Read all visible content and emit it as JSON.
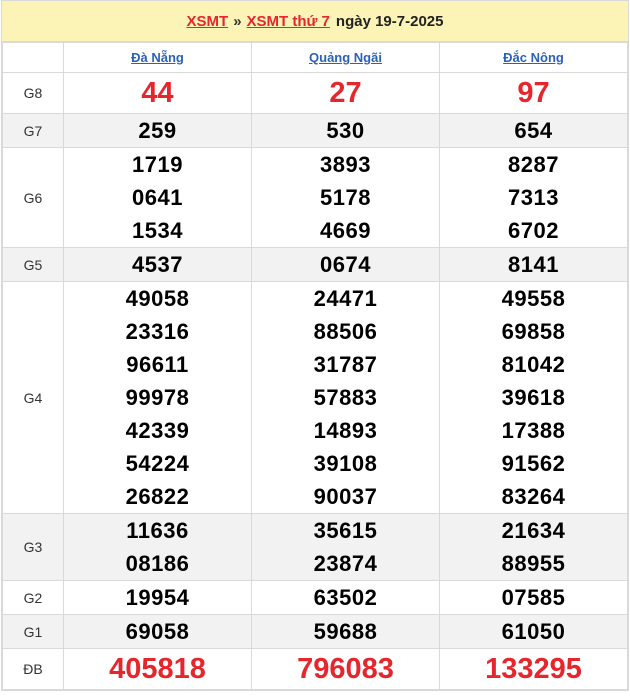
{
  "header": {
    "link1": "XSMT",
    "separator": "»",
    "link2": "XSMT thứ 7",
    "date": "ngày 19-7-2025"
  },
  "provinces": [
    "Đà Nẵng",
    "Quảng Ngãi",
    "Đắc Nông"
  ],
  "prizes": [
    {
      "label": "G8",
      "values": [
        [
          "44"
        ],
        [
          "27"
        ],
        [
          "97"
        ]
      ]
    },
    {
      "label": "G7",
      "values": [
        [
          "259"
        ],
        [
          "530"
        ],
        [
          "654"
        ]
      ]
    },
    {
      "label": "G6",
      "values": [
        [
          "1719",
          "0641",
          "1534"
        ],
        [
          "3893",
          "5178",
          "4669"
        ],
        [
          "8287",
          "7313",
          "6702"
        ]
      ]
    },
    {
      "label": "G5",
      "values": [
        [
          "4537"
        ],
        [
          "0674"
        ],
        [
          "8141"
        ]
      ]
    },
    {
      "label": "G4",
      "values": [
        [
          "49058",
          "23316",
          "96611",
          "99978",
          "42339",
          "54224",
          "26822"
        ],
        [
          "24471",
          "88506",
          "31787",
          "57883",
          "14893",
          "39108",
          "90037"
        ],
        [
          "49558",
          "69858",
          "81042",
          "39618",
          "17388",
          "91562",
          "83264"
        ]
      ]
    },
    {
      "label": "G3",
      "values": [
        [
          "11636",
          "08186"
        ],
        [
          "35615",
          "23874"
        ],
        [
          "21634",
          "88955"
        ]
      ]
    },
    {
      "label": "G2",
      "values": [
        [
          "19954"
        ],
        [
          "63502"
        ],
        [
          "07585"
        ]
      ]
    },
    {
      "label": "G1",
      "values": [
        [
          "69058"
        ],
        [
          "59688"
        ],
        [
          "61050"
        ]
      ]
    },
    {
      "label": "ĐB",
      "values": [
        [
          "405818"
        ],
        [
          "796083"
        ],
        [
          "133295"
        ]
      ]
    }
  ]
}
